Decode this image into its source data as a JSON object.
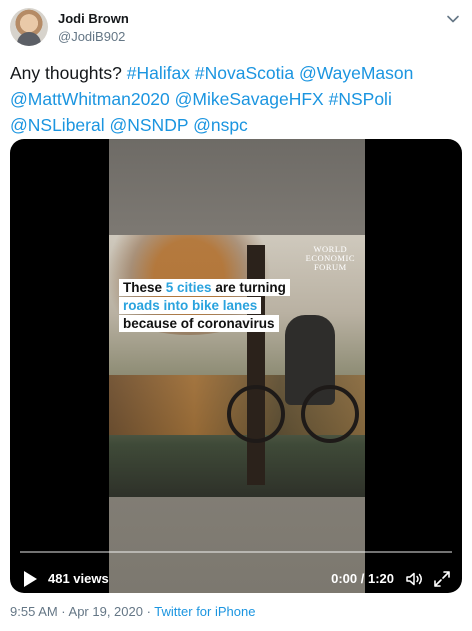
{
  "author": {
    "name": "Jodi Brown",
    "handle": "@JodiB902"
  },
  "tweet": {
    "parts": [
      {
        "text": "Any thoughts? ",
        "link": false
      },
      {
        "text": "#Halifax",
        "link": true
      },
      {
        "text": " ",
        "link": false
      },
      {
        "text": "#NovaScotia",
        "link": true
      },
      {
        "text": " ",
        "link": false
      },
      {
        "text": "@WayeMason",
        "link": true
      },
      {
        "text": " ",
        "link": false
      },
      {
        "text": "@MattWhitman2020",
        "link": true
      },
      {
        "text": " ",
        "link": false
      },
      {
        "text": "@MikeSavageHFX",
        "link": true
      },
      {
        "text": " ",
        "link": false
      },
      {
        "text": "#NSPoli",
        "link": true
      },
      {
        "text": " ",
        "link": false
      },
      {
        "text": "@NSLiberal",
        "link": true
      },
      {
        "text": " ",
        "link": false
      },
      {
        "text": "@NSNDP",
        "link": true
      },
      {
        "text": " ",
        "link": false
      },
      {
        "text": "@nspc",
        "link": true
      }
    ]
  },
  "video": {
    "caption": {
      "line1_a": "These ",
      "line1_b": "5 cities",
      "line1_c": " are turning",
      "line2": "roads into bike lanes",
      "line3": "because of coronavirus"
    },
    "watermark": [
      "WORLD",
      "ECONOMIC",
      "FORUM"
    ],
    "views": "481 views",
    "time": "0:00 / 1:20",
    "progress": 0
  },
  "meta": {
    "timestamp": "9:55 AM · Apr 19, 2020 · ",
    "source": "Twitter for iPhone"
  },
  "colors": {
    "link": "#1b95e0",
    "caption_highlight": "#2aa3de"
  },
  "icons": {
    "more": "chevron-down-icon",
    "play": "play-icon",
    "volume": "volume-icon",
    "fullscreen": "fullscreen-icon"
  }
}
